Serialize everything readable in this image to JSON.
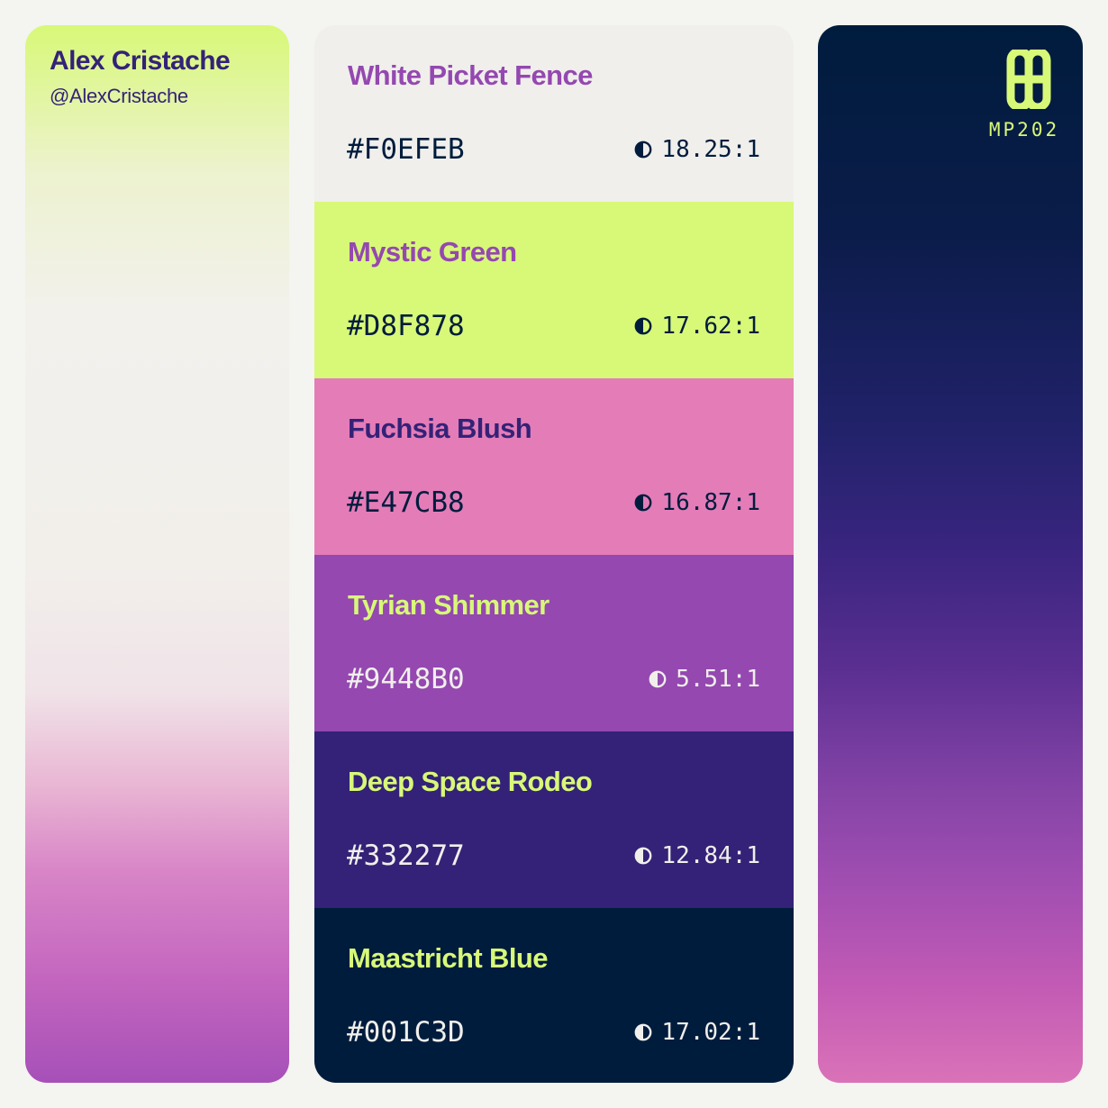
{
  "author": {
    "name": "Alex Cristache",
    "handle": "@AlexCristache"
  },
  "brand": {
    "logo_icon": "mp-logo-icon",
    "logo_text": "MP202",
    "logo_color": "#D8F878"
  },
  "swatches": [
    {
      "name": "White Picket Fence",
      "hex": "#F0EFEB",
      "contrast": "18.25:1",
      "background": "#F0EFEB",
      "name_color": "#9448B0",
      "text_color": "#001C3D"
    },
    {
      "name": "Mystic Green",
      "hex": "#D8F878",
      "contrast": "17.62:1",
      "background": "#D8F878",
      "name_color": "#9448B0",
      "text_color": "#001C3D"
    },
    {
      "name": "Fuchsia Blush",
      "hex": "#E47CB8",
      "contrast": "16.87:1",
      "background": "#E47CB8",
      "name_color": "#332277",
      "text_color": "#001C3D"
    },
    {
      "name": "Tyrian Shimmer",
      "hex": "#9448B0",
      "contrast": "5.51:1",
      "background": "#9448B0",
      "name_color": "#D8F878",
      "text_color": "#F0EFEB"
    },
    {
      "name": "Deep Space Rodeo",
      "hex": "#332277",
      "contrast": "12.84:1",
      "background": "#332277",
      "name_color": "#D8F878",
      "text_color": "#F0EFEB"
    },
    {
      "name": "Maastricht Blue",
      "hex": "#001C3D",
      "contrast": "17.02:1",
      "background": "#001C3D",
      "name_color": "#D8F878",
      "text_color": "#F0EFEB"
    }
  ]
}
